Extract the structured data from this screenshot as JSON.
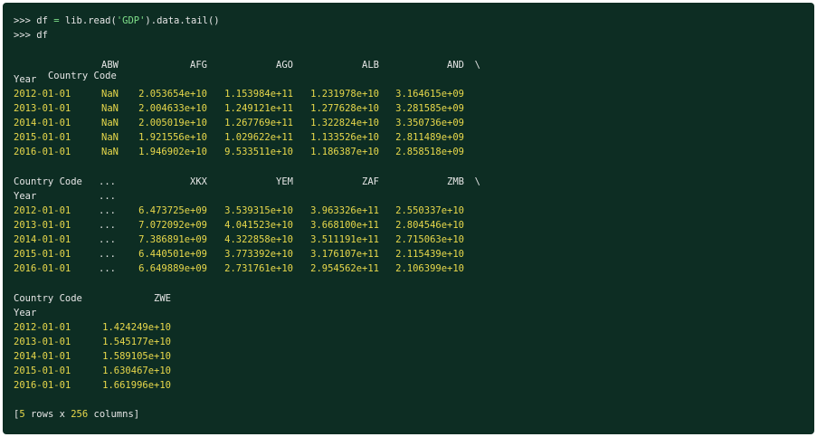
{
  "prompt": {
    "line1": {
      "p": ">>> ",
      "a": "df ",
      "eq": "=",
      "b": " lib.read(",
      "s": "'GDP'",
      "c": ").data.tail()"
    },
    "line2": {
      "p": ">>> ",
      "a": "df"
    }
  },
  "blocks": [
    {
      "header": [
        "Country Code",
        "ABW",
        "AFG",
        "AGO",
        "ALB",
        "AND",
        "\\"
      ],
      "index_name": "Year",
      "rows": [
        [
          "2012-01-01",
          "NaN",
          "2.053654e+10",
          "1.153984e+11",
          "1.231978e+10",
          "3.164615e+09"
        ],
        [
          "2013-01-01",
          "NaN",
          "2.004633e+10",
          "1.249121e+11",
          "1.277628e+10",
          "3.281585e+09"
        ],
        [
          "2014-01-01",
          "NaN",
          "2.005019e+10",
          "1.267769e+11",
          "1.322824e+10",
          "3.350736e+09"
        ],
        [
          "2015-01-01",
          "NaN",
          "1.921556e+10",
          "1.029622e+11",
          "1.133526e+10",
          "2.811489e+09"
        ],
        [
          "2016-01-01",
          "NaN",
          "1.946902e+10",
          "9.533511e+10",
          "1.186387e+10",
          "2.858518e+09"
        ]
      ]
    },
    {
      "header": [
        "Country Code",
        "...",
        "XKX",
        "YEM",
        "ZAF",
        "ZMB",
        "\\"
      ],
      "index_name": "Year",
      "index_ellipsis": "...",
      "rows": [
        [
          "2012-01-01",
          "...",
          "6.473725e+09",
          "3.539315e+10",
          "3.963326e+11",
          "2.550337e+10"
        ],
        [
          "2013-01-01",
          "...",
          "7.072092e+09",
          "4.041523e+10",
          "3.668100e+11",
          "2.804546e+10"
        ],
        [
          "2014-01-01",
          "...",
          "7.386891e+09",
          "4.322858e+10",
          "3.511191e+11",
          "2.715063e+10"
        ],
        [
          "2015-01-01",
          "...",
          "6.440501e+09",
          "3.773392e+10",
          "3.176107e+11",
          "2.115439e+10"
        ],
        [
          "2016-01-01",
          "...",
          "6.649889e+09",
          "2.731761e+10",
          "2.954562e+11",
          "2.106399e+10"
        ]
      ]
    },
    {
      "header": [
        "Country Code",
        "ZWE"
      ],
      "index_name": "Year",
      "rows": [
        [
          "2012-01-01",
          "1.424249e+10"
        ],
        [
          "2013-01-01",
          "1.545177e+10"
        ],
        [
          "2014-01-01",
          "1.589105e+10"
        ],
        [
          "2015-01-01",
          "1.630467e+10"
        ],
        [
          "2016-01-01",
          "1.661996e+10"
        ]
      ]
    }
  ],
  "footer": {
    "a": "[",
    "rows": "5",
    "b": " rows x ",
    "cols": "256",
    "c": " columns]"
  }
}
